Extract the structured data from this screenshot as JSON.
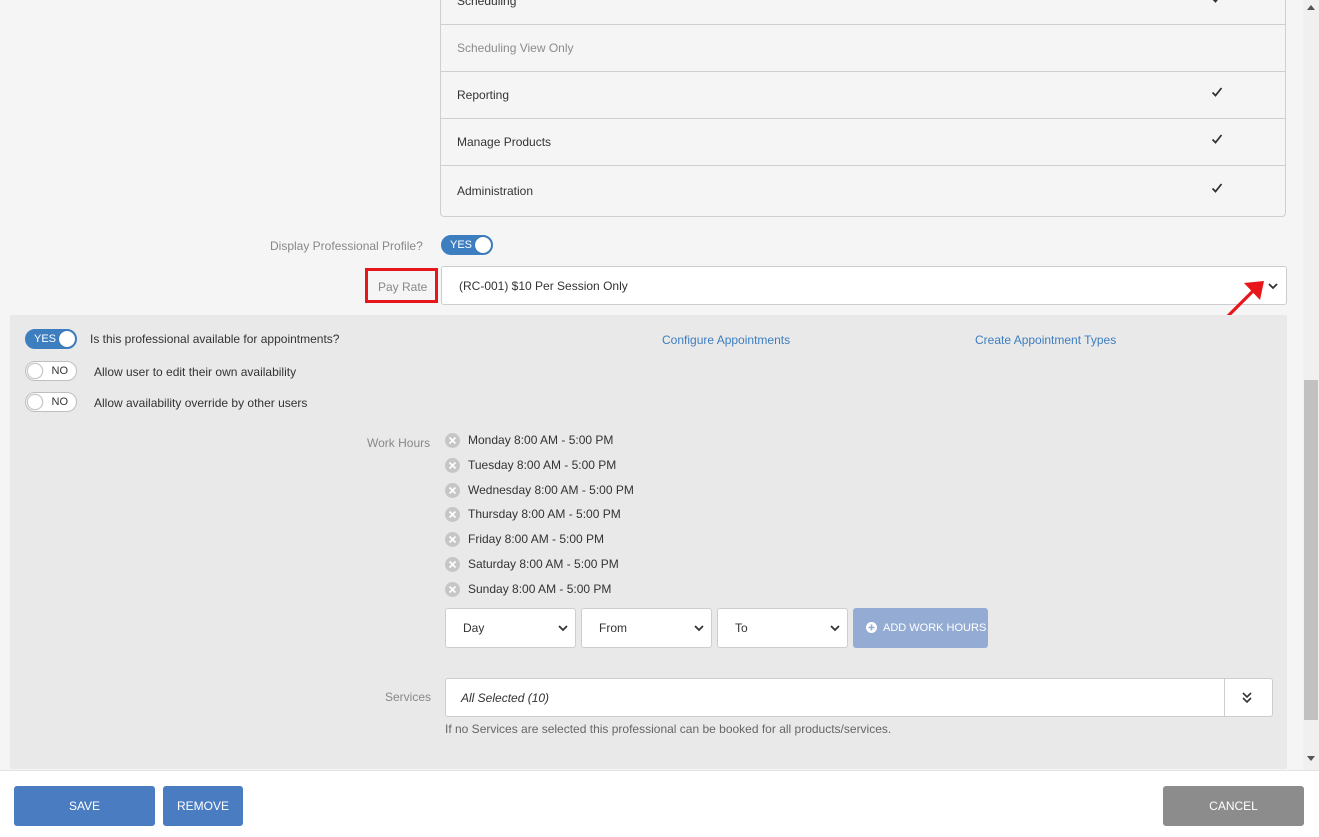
{
  "permissions": [
    {
      "label": "Scheduling",
      "checked": true,
      "muted": false
    },
    {
      "label": "Scheduling View Only",
      "checked": false,
      "muted": true
    },
    {
      "label": "Reporting",
      "checked": true,
      "muted": false
    },
    {
      "label": "Manage Products",
      "checked": true,
      "muted": false
    },
    {
      "label": "Administration",
      "checked": true,
      "muted": false
    }
  ],
  "display_profile": {
    "label": "Display Professional Profile?",
    "toggle": "YES",
    "on": true
  },
  "pay_rate": {
    "label": "Pay Rate",
    "value": "(RC-001) $10 Per Session Only"
  },
  "availability": {
    "available": {
      "toggle": "YES",
      "on": true,
      "label": "Is this professional available for appointments?"
    },
    "edit_own": {
      "toggle": "NO",
      "on": false,
      "label": "Allow user to edit their own availability"
    },
    "override": {
      "toggle": "NO",
      "on": false,
      "label": "Allow availability override by other users"
    },
    "configure_link": "Configure Appointments",
    "create_types_link": "Create Appointment Types"
  },
  "work_hours": {
    "label": "Work Hours",
    "items": [
      "Monday 8:00 AM - 5:00 PM",
      "Tuesday 8:00 AM - 5:00 PM",
      "Wednesday 8:00 AM - 5:00 PM",
      "Thursday 8:00 AM - 5:00 PM",
      "Friday 8:00 AM - 5:00 PM",
      "Saturday 8:00 AM - 5:00 PM",
      "Sunday 8:00 AM - 5:00 PM"
    ],
    "day_select": "Day",
    "from_select": "From",
    "to_select": "To",
    "add_button": "ADD WORK HOURS"
  },
  "services": {
    "label": "Services",
    "value": "All Selected (10)",
    "hint": "If no Services are selected this professional can be booked for all products/services."
  },
  "actions": {
    "save": "SAVE",
    "remove": "REMOVE",
    "cancel": "CANCEL"
  },
  "colors": {
    "primary": "#4a7cc1",
    "toggle_on": "#3d7ec1",
    "link": "#3d7ec1",
    "cancel": "#8c8c8c",
    "disabled_button": "#94acd3",
    "annotation_red": "#e8151b"
  },
  "icons": {
    "check": "check-icon",
    "remove_hour": "x-circle-icon",
    "chevron": "chevron-down-icon",
    "double_chevron": "double-chevron-down-icon",
    "add": "plus-circle-icon",
    "annotation_arrow": "red-arrow-icon"
  }
}
